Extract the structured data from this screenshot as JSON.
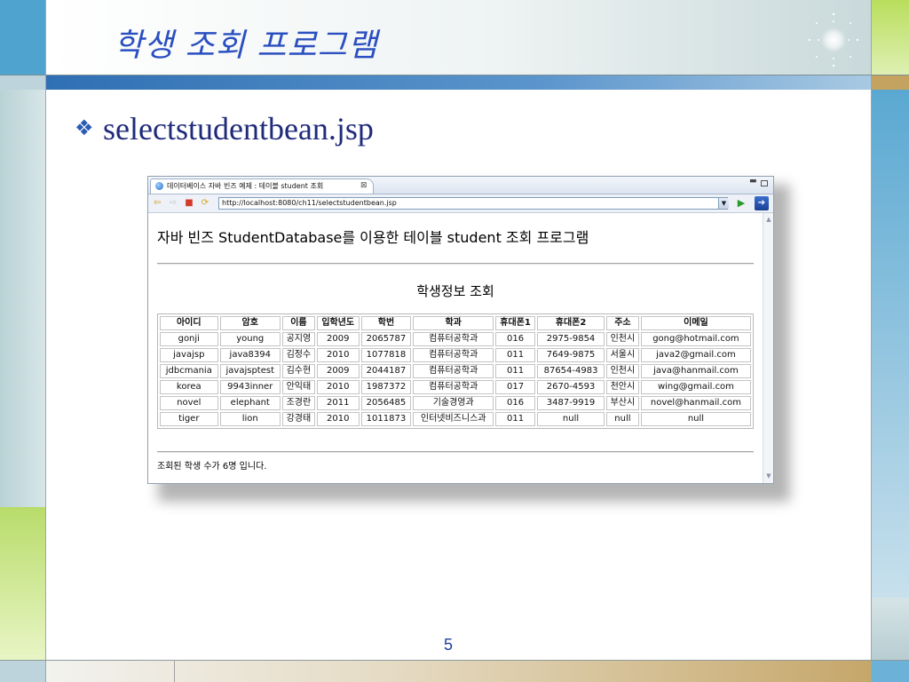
{
  "slide": {
    "title": "학생 조회 프로그램",
    "bullet_icon": "diamond-bullet-icon",
    "subtitle": "selectstudentbean.jsp",
    "page_number": "5"
  },
  "browser": {
    "tab_title": "데이터베이스 자바 빈즈 예제 : 테이블 student 조회",
    "tab_close": "⊠",
    "url": "http://localhost:8080/ch11/selectstudentbean.jsp",
    "icons": [
      "back-arrow-icon",
      "forward-arrow-icon",
      "stop-icon",
      "refresh-icon",
      "go-icon",
      "navigate-icon"
    ]
  },
  "page": {
    "heading": "자바 빈즈 StudentDatabase를 이용한 테이블 student 조회 프로그램",
    "table_title": "학생정보 조회",
    "columns": [
      "아이디",
      "암호",
      "이름",
      "입학년도",
      "학번",
      "학과",
      "휴대폰1",
      "휴대폰2",
      "주소",
      "이메일"
    ],
    "rows": [
      [
        "gonji",
        "young",
        "공지영",
        "2009",
        "2065787",
        "컴퓨터공학과",
        "016",
        "2975-9854",
        "인천시",
        "gong@hotmail.com"
      ],
      [
        "javajsp",
        "java8394",
        "김정수",
        "2010",
        "1077818",
        "컴퓨터공학과",
        "011",
        "7649-9875",
        "서울시",
        "java2@gmail.com"
      ],
      [
        "jdbcmania",
        "javajsptest",
        "김수현",
        "2009",
        "2044187",
        "컴퓨터공학과",
        "011",
        "87654-4983",
        "인천시",
        "java@hanmail.com"
      ],
      [
        "korea",
        "9943inner",
        "안익태",
        "2010",
        "1987372",
        "컴퓨터공학과",
        "017",
        "2670-4593",
        "천안시",
        "wing@gmail.com"
      ],
      [
        "novel",
        "elephant",
        "조경란",
        "2011",
        "2056485",
        "기술경영과",
        "016",
        "3487-9919",
        "부산시",
        "novel@hanmail.com"
      ],
      [
        "tiger",
        "lion",
        "강경태",
        "2010",
        "1011873",
        "인터넷비즈니스과",
        "011",
        "null",
        "null",
        "null"
      ]
    ],
    "footer": "조회된 학생 수가 6명 입니다."
  }
}
